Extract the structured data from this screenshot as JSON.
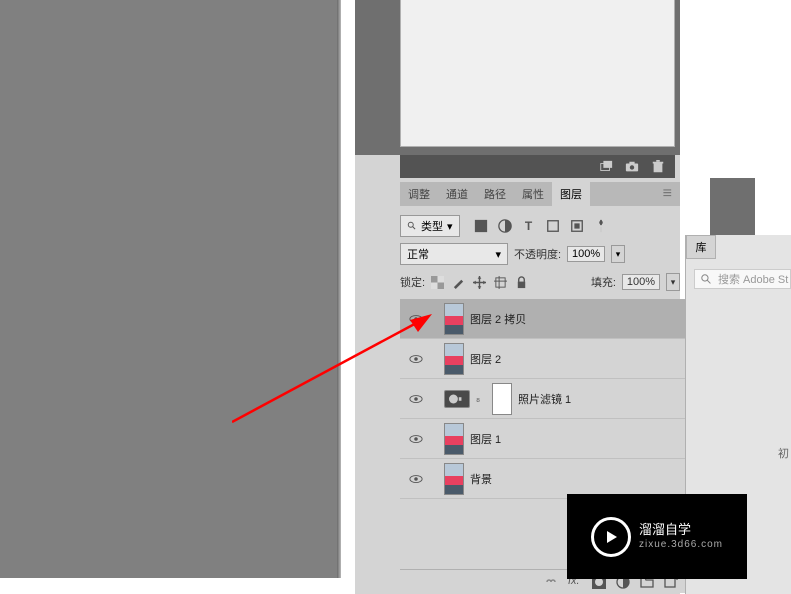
{
  "tabs": {
    "adjust": "调整",
    "channels": "通道",
    "paths": "路径",
    "properties": "属性",
    "layers": "图层"
  },
  "filter": {
    "type_label": "类型"
  },
  "blend": {
    "mode": "正常",
    "opacity_label": "不透明度:",
    "opacity_value": "100%"
  },
  "lock": {
    "label": "锁定:",
    "fill_label": "填充:",
    "fill_value": "100%"
  },
  "layers": [
    {
      "name": "图层 2 拷贝",
      "selected": true,
      "type": "image"
    },
    {
      "name": "图层 2",
      "selected": false,
      "type": "image"
    },
    {
      "name": "照片滤镜 1",
      "selected": false,
      "type": "adjustment"
    },
    {
      "name": "图层 1",
      "selected": false,
      "type": "image"
    },
    {
      "name": "背景",
      "selected": false,
      "type": "image",
      "locked": true
    }
  ],
  "library": {
    "tab": "库",
    "search_placeholder": "搜索 Adobe St",
    "status": "初"
  },
  "watermark": {
    "title": "溜溜自学",
    "sub": "zixue.3d66.com"
  }
}
